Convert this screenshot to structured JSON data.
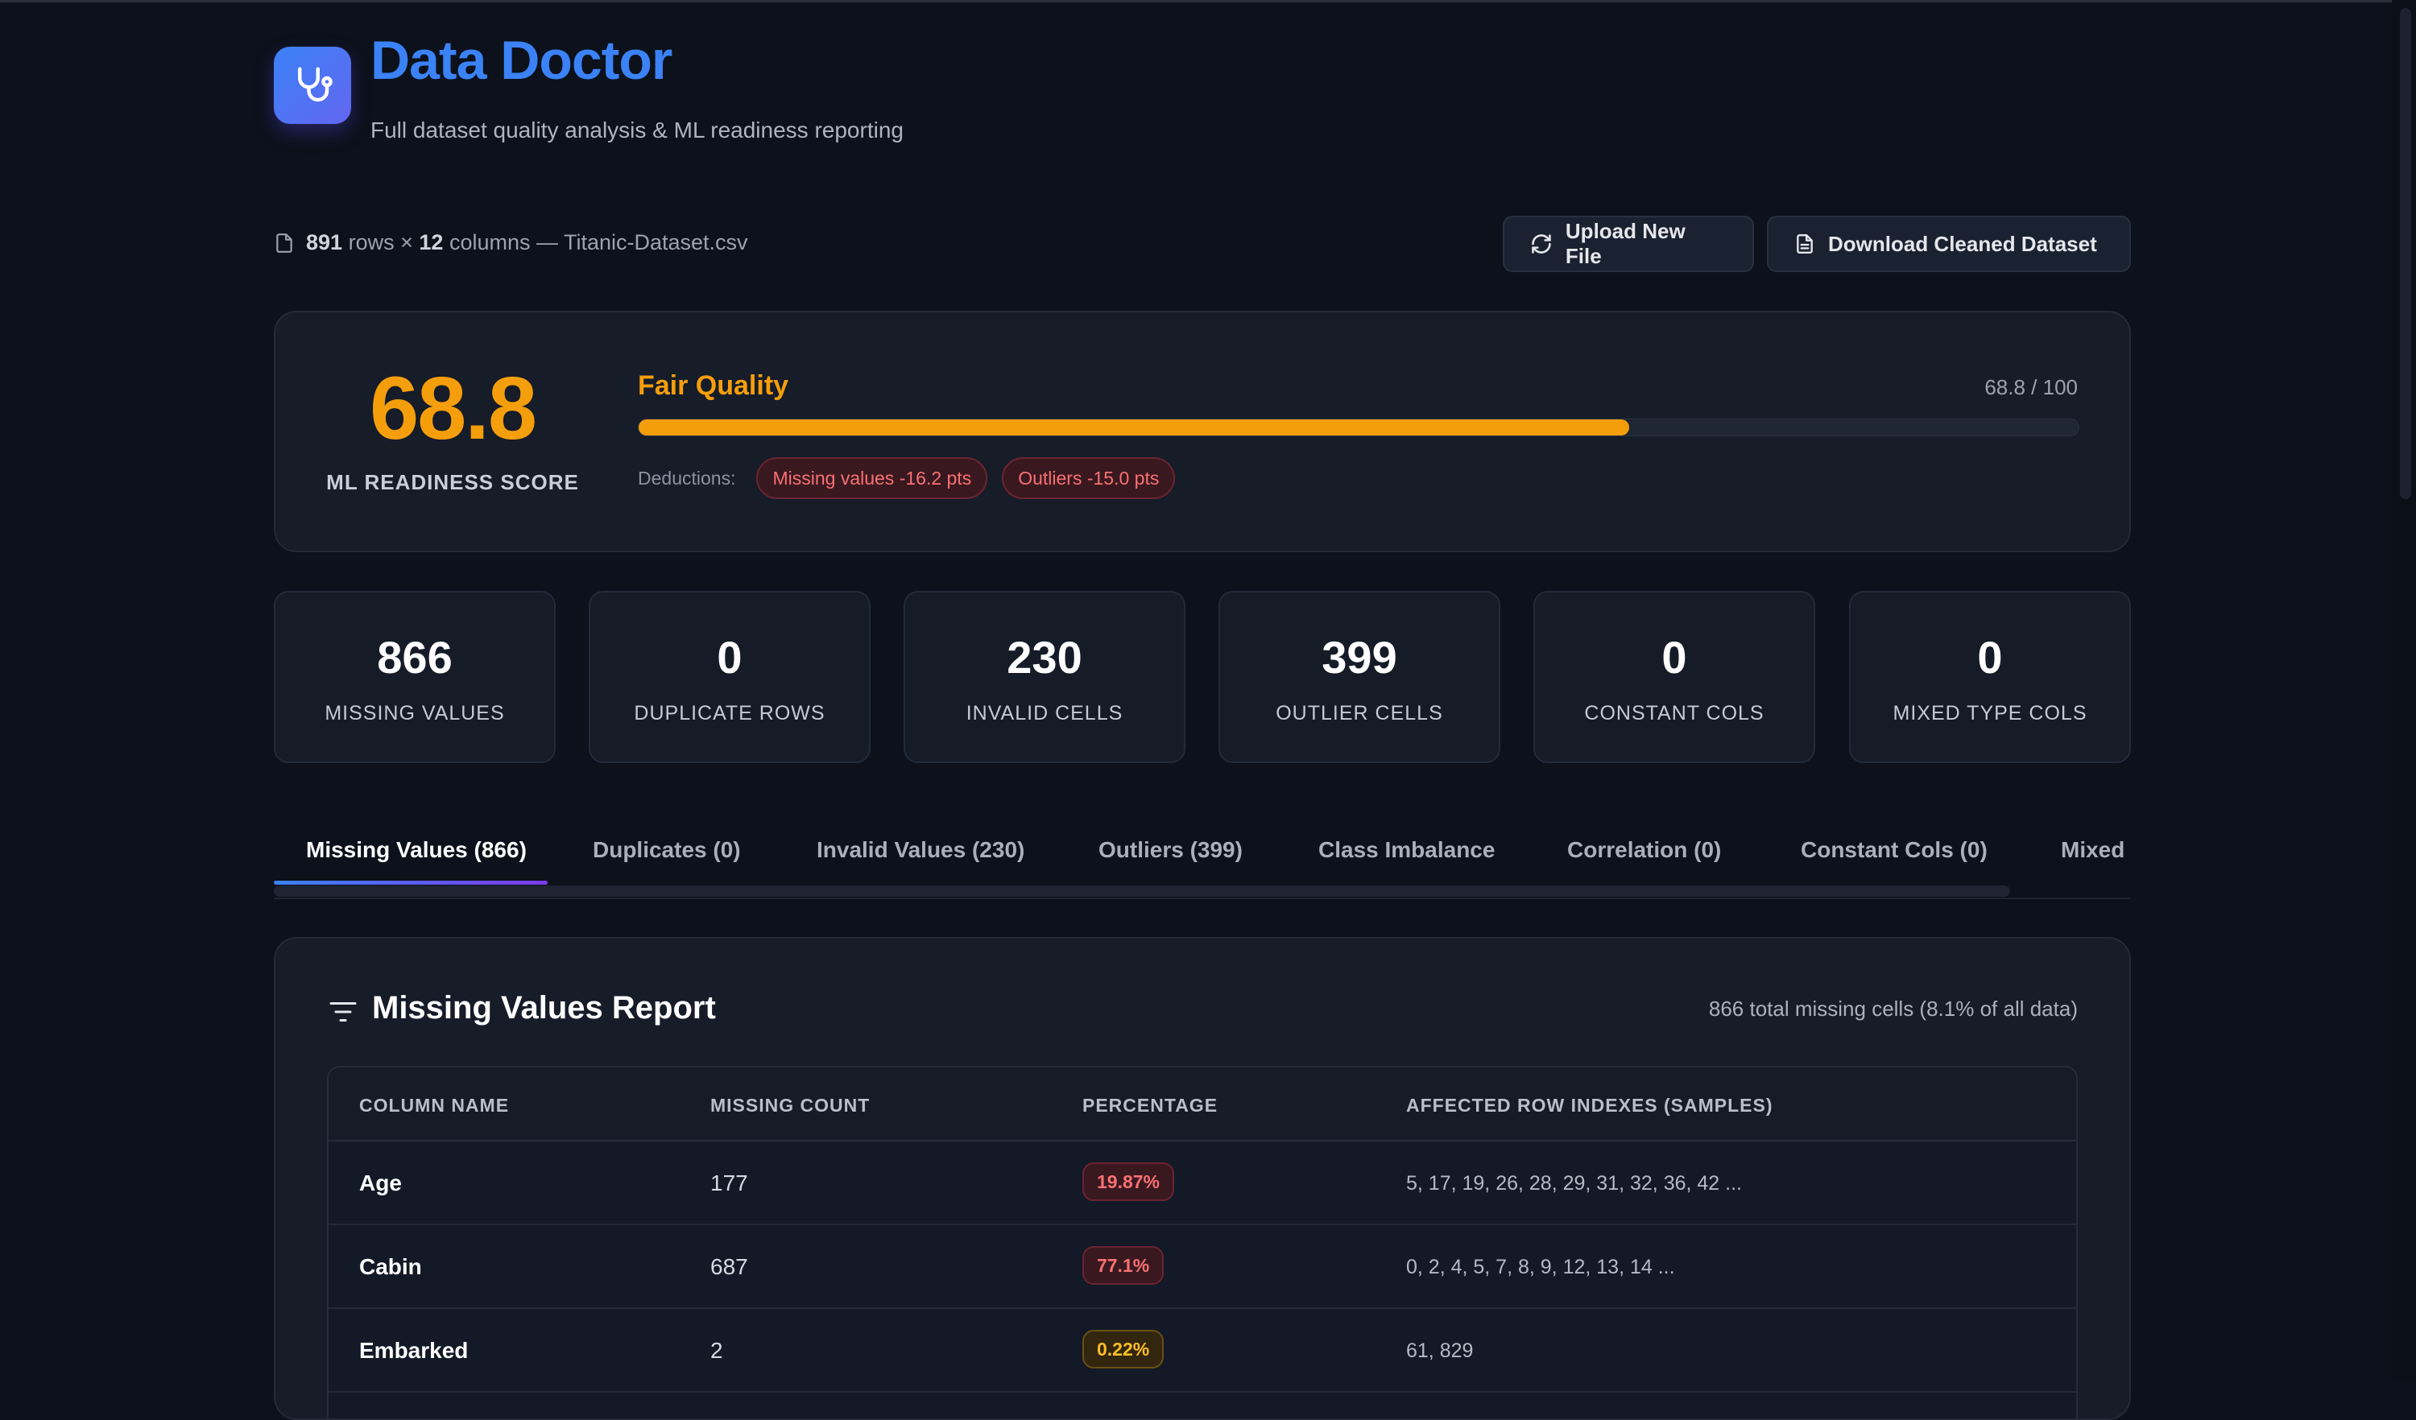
{
  "app": {
    "title": "Data Doctor",
    "subtitle": "Full dataset quality analysis & ML readiness reporting"
  },
  "file": {
    "rows": "891",
    "rows_word": "rows ×",
    "cols": "12",
    "cols_word": "columns — Titanic-Dataset.csv"
  },
  "actions": {
    "upload_label": "Upload New File",
    "download_label": "Download Cleaned Dataset"
  },
  "score": {
    "value": "68.8",
    "label": "ML READINESS SCORE",
    "quality": "Fair Quality",
    "of_text": "68.8 / 100",
    "progress_fraction": 0.688,
    "deductions_label": "Deductions:",
    "deductions": [
      "Missing values -16.2 pts",
      "Outliers -15.0 pts"
    ],
    "accent_color": "#f59e0b"
  },
  "stats": [
    {
      "value": "866",
      "label": "MISSING VALUES"
    },
    {
      "value": "0",
      "label": "DUPLICATE ROWS"
    },
    {
      "value": "230",
      "label": "INVALID CELLS"
    },
    {
      "value": "399",
      "label": "OUTLIER CELLS"
    },
    {
      "value": "0",
      "label": "CONSTANT COLS"
    },
    {
      "value": "0",
      "label": "MIXED TYPE COLS"
    }
  ],
  "tabs": [
    "Missing Values (866)",
    "Duplicates (0)",
    "Invalid Values (230)",
    "Outliers (399)",
    "Class Imbalance",
    "Correlation (0)",
    "Constant Cols (0)",
    "Mixed"
  ],
  "report": {
    "title": "Missing Values Report",
    "summary": "866 total missing cells (8.1% of all data)",
    "columns": [
      "COLUMN NAME",
      "MISSING COUNT",
      "PERCENTAGE",
      "AFFECTED ROW INDEXES (SAMPLES)"
    ],
    "rows": [
      {
        "name": "Age",
        "count": "177",
        "percentage": "19.87%",
        "rows": "5, 17, 19, 26, 28, 29, 31, 32, 36, 42 ..."
      },
      {
        "name": "Cabin",
        "count": "687",
        "percentage": "77.1%",
        "rows": "0, 2, 4, 5, 7, 8, 9, 12, 13, 14 ..."
      },
      {
        "name": "Embarked",
        "count": "2",
        "percentage": "0.22%",
        "rows": "61, 829"
      }
    ]
  }
}
